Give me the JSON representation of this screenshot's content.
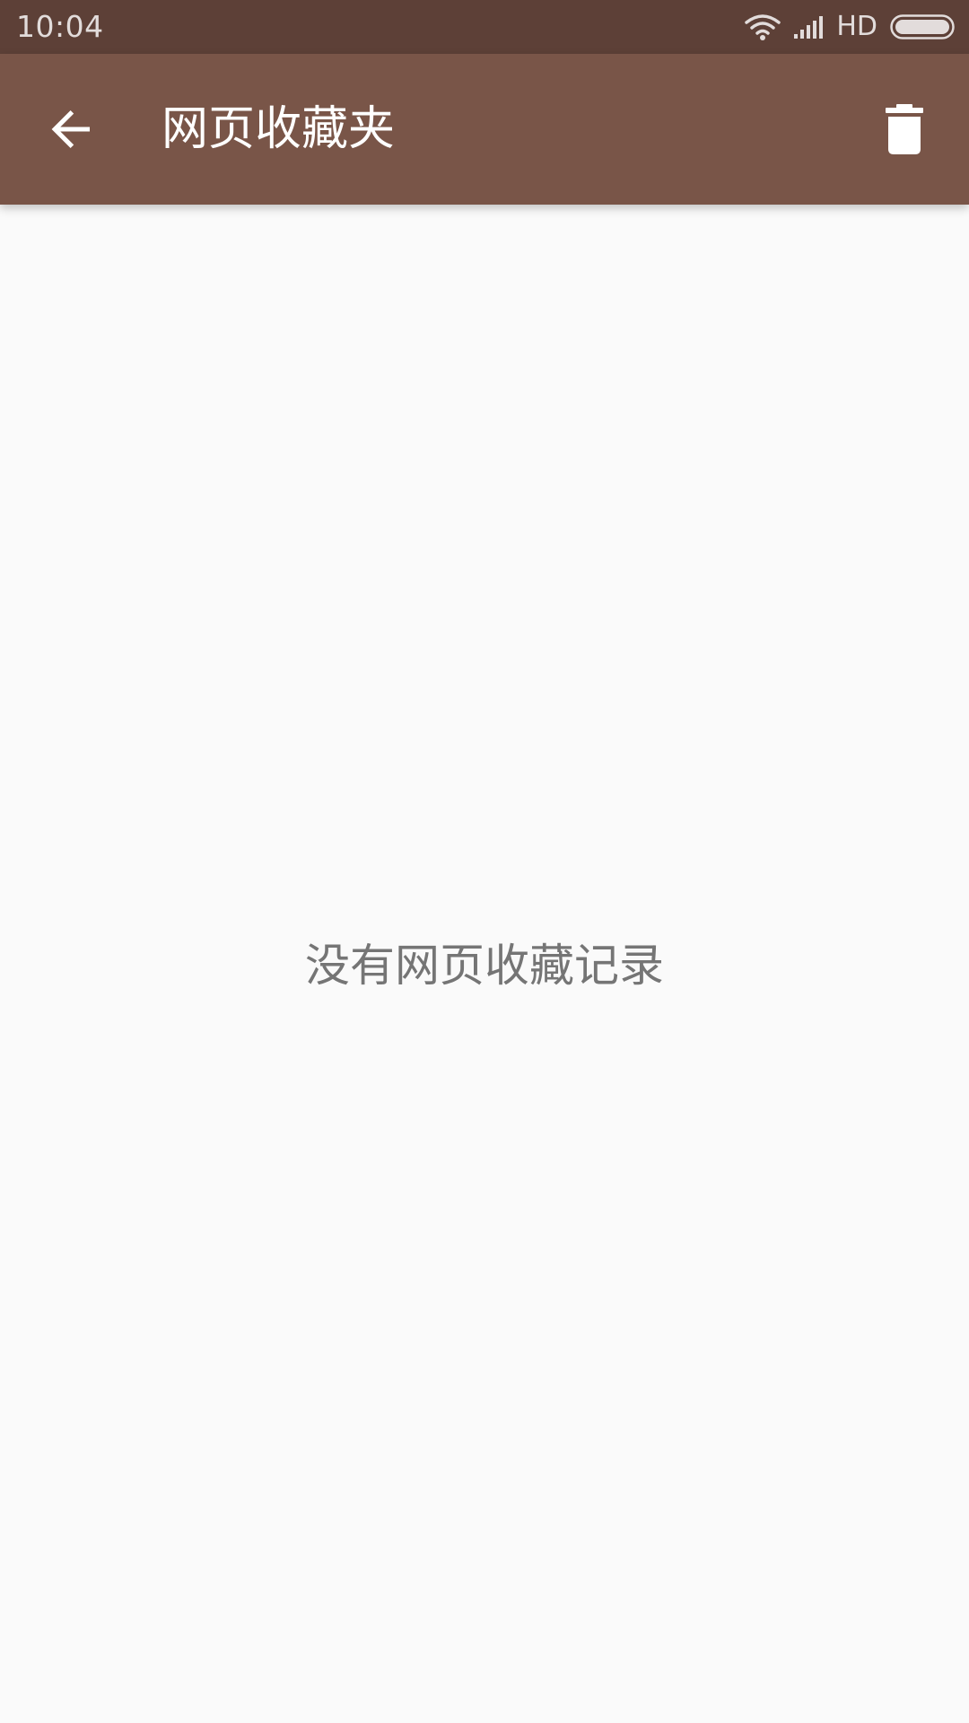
{
  "status_bar": {
    "time": "10:04",
    "network_label": "HD",
    "icons": [
      "wifi-icon",
      "signal-icon",
      "battery-icon"
    ],
    "background_color": "#5d4037"
  },
  "app_bar": {
    "title": "网页收藏夹",
    "back_icon": "arrow-back-icon",
    "action_icon": "trash-icon",
    "background_color": "#795548"
  },
  "content": {
    "empty_message": "没有网页收藏记录",
    "background_color": "#fafafa"
  }
}
